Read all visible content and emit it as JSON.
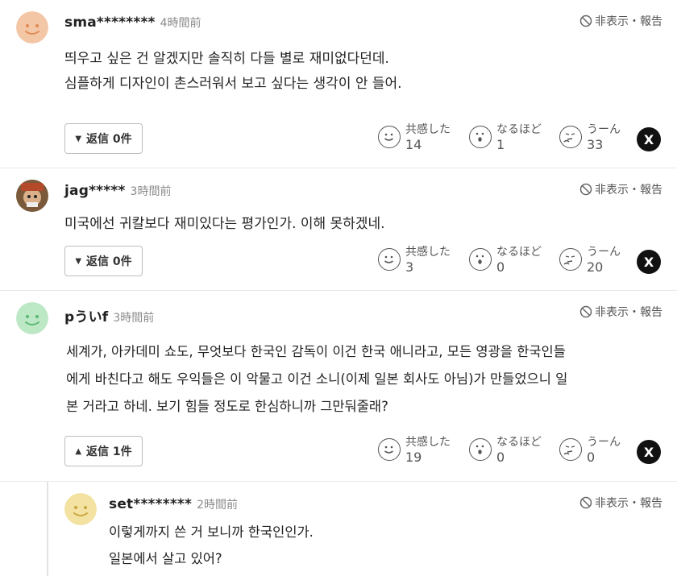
{
  "hide_label": "非表示・報告",
  "reaction_labels": [
    "共感した",
    "なるほど",
    "うーん"
  ],
  "share_icon_label": "X",
  "colors": {
    "avatar_orange": "#f3c6a6",
    "avatar_green": "#bde8c6",
    "avatar_yellow": "#f3e2a2",
    "x_button": "#111111"
  },
  "comments": [
    {
      "user": "sma********",
      "time": "4時間前",
      "lines": [
        "띄우고 싶은 건 알겠지만 솔직히 다들 별로 재미없다던데.",
        "심플하게 디자인이 촌스러워서 보고 싶다는 생각이 안 들어."
      ],
      "reply_button": "返信 0件",
      "reply_arrow": "down",
      "counts": [
        "14",
        "1",
        "33"
      ]
    },
    {
      "user": "jag*****",
      "time": "3時間前",
      "lines": [
        "미국에선 귀칼보다 재미있다는 평가인가. 이해 못하겠네."
      ],
      "reply_button": "返信 0件",
      "reply_arrow": "down",
      "counts": [
        "3",
        "0",
        "20"
      ]
    },
    {
      "user": "pういf",
      "time": "3時間前",
      "lines": [
        "세계가, 아카데미 쇼도, 무엇보다 한국인 감독이 이건 한국 애니라고, 모든 영광을 한국인들",
        "에게 바친다고 해도 우익들은 이 악물고 이건 소니(이제 일본 회사도 아님)가 만들었으니 일",
        "본 거라고 하네. 보기 힘들 정도로 한심하니까 그만둬줄래?"
      ],
      "reply_button": "返信 1件",
      "reply_arrow": "up",
      "counts": [
        "19",
        "0",
        "0"
      ]
    },
    {
      "user": "set********",
      "time": "2時間前",
      "lines": [
        "이렇게까지 쓴 거 보니까 한국인인가.",
        "일본에서 살고 있어?"
      ]
    }
  ]
}
